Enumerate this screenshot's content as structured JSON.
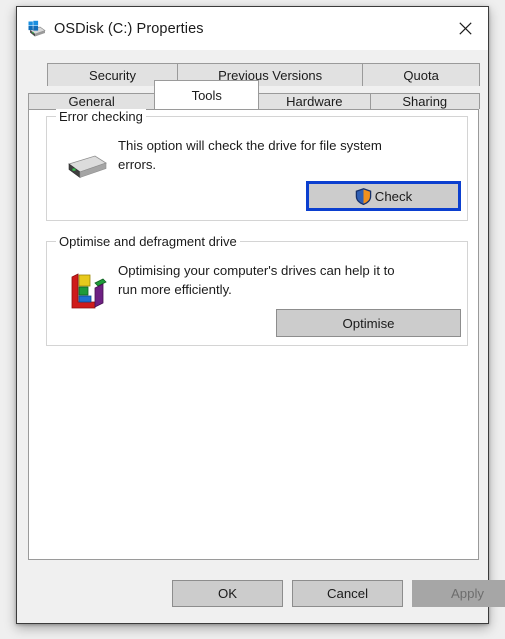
{
  "window": {
    "title": "OSDisk (C:) Properties",
    "title_icon": "drive-windows-icon",
    "close_icon": "close-icon"
  },
  "tabs": {
    "row1": [
      {
        "label": "Security",
        "selected": false
      },
      {
        "label": "Previous Versions",
        "selected": false
      },
      {
        "label": "Quota",
        "selected": false
      }
    ],
    "row2": [
      {
        "label": "General",
        "selected": false
      },
      {
        "label": "Tools",
        "selected": true
      },
      {
        "label": "Hardware",
        "selected": false
      },
      {
        "label": "Sharing",
        "selected": false
      }
    ]
  },
  "error_checking": {
    "group_title": "Error checking",
    "icon": "hard-drive-icon",
    "description": "This option will check the drive for file system errors.",
    "button_label": "Check",
    "button_shield_icon": "uac-shield-icon",
    "button_is_default": true
  },
  "optimise": {
    "group_title": "Optimise and defragment drive",
    "icon": "defragment-icon",
    "description": "Optimising your computer's drives can help it to run more efficiently.",
    "button_label": "Optimise"
  },
  "footer": {
    "ok_label": "OK",
    "cancel_label": "Cancel",
    "apply_label": "Apply",
    "apply_disabled": true
  },
  "colors": {
    "dialog_background": "#f0f0f0",
    "tabpage_background": "#ffffff",
    "tab_inactive": "#e1e1e1",
    "tab_border": "#9a9a9a",
    "button_face": "#cccccc",
    "button_border": "#8d8d8d",
    "default_focus_border": "#0b3fcf",
    "disabled_face": "#a6a6a6",
    "disabled_text": "#6d6d6d",
    "text": "#1b1b1b",
    "groupbox_border": "#d4d4d4",
    "shield_blue": "#2f5fb4",
    "shield_orange": "#f0911e"
  }
}
